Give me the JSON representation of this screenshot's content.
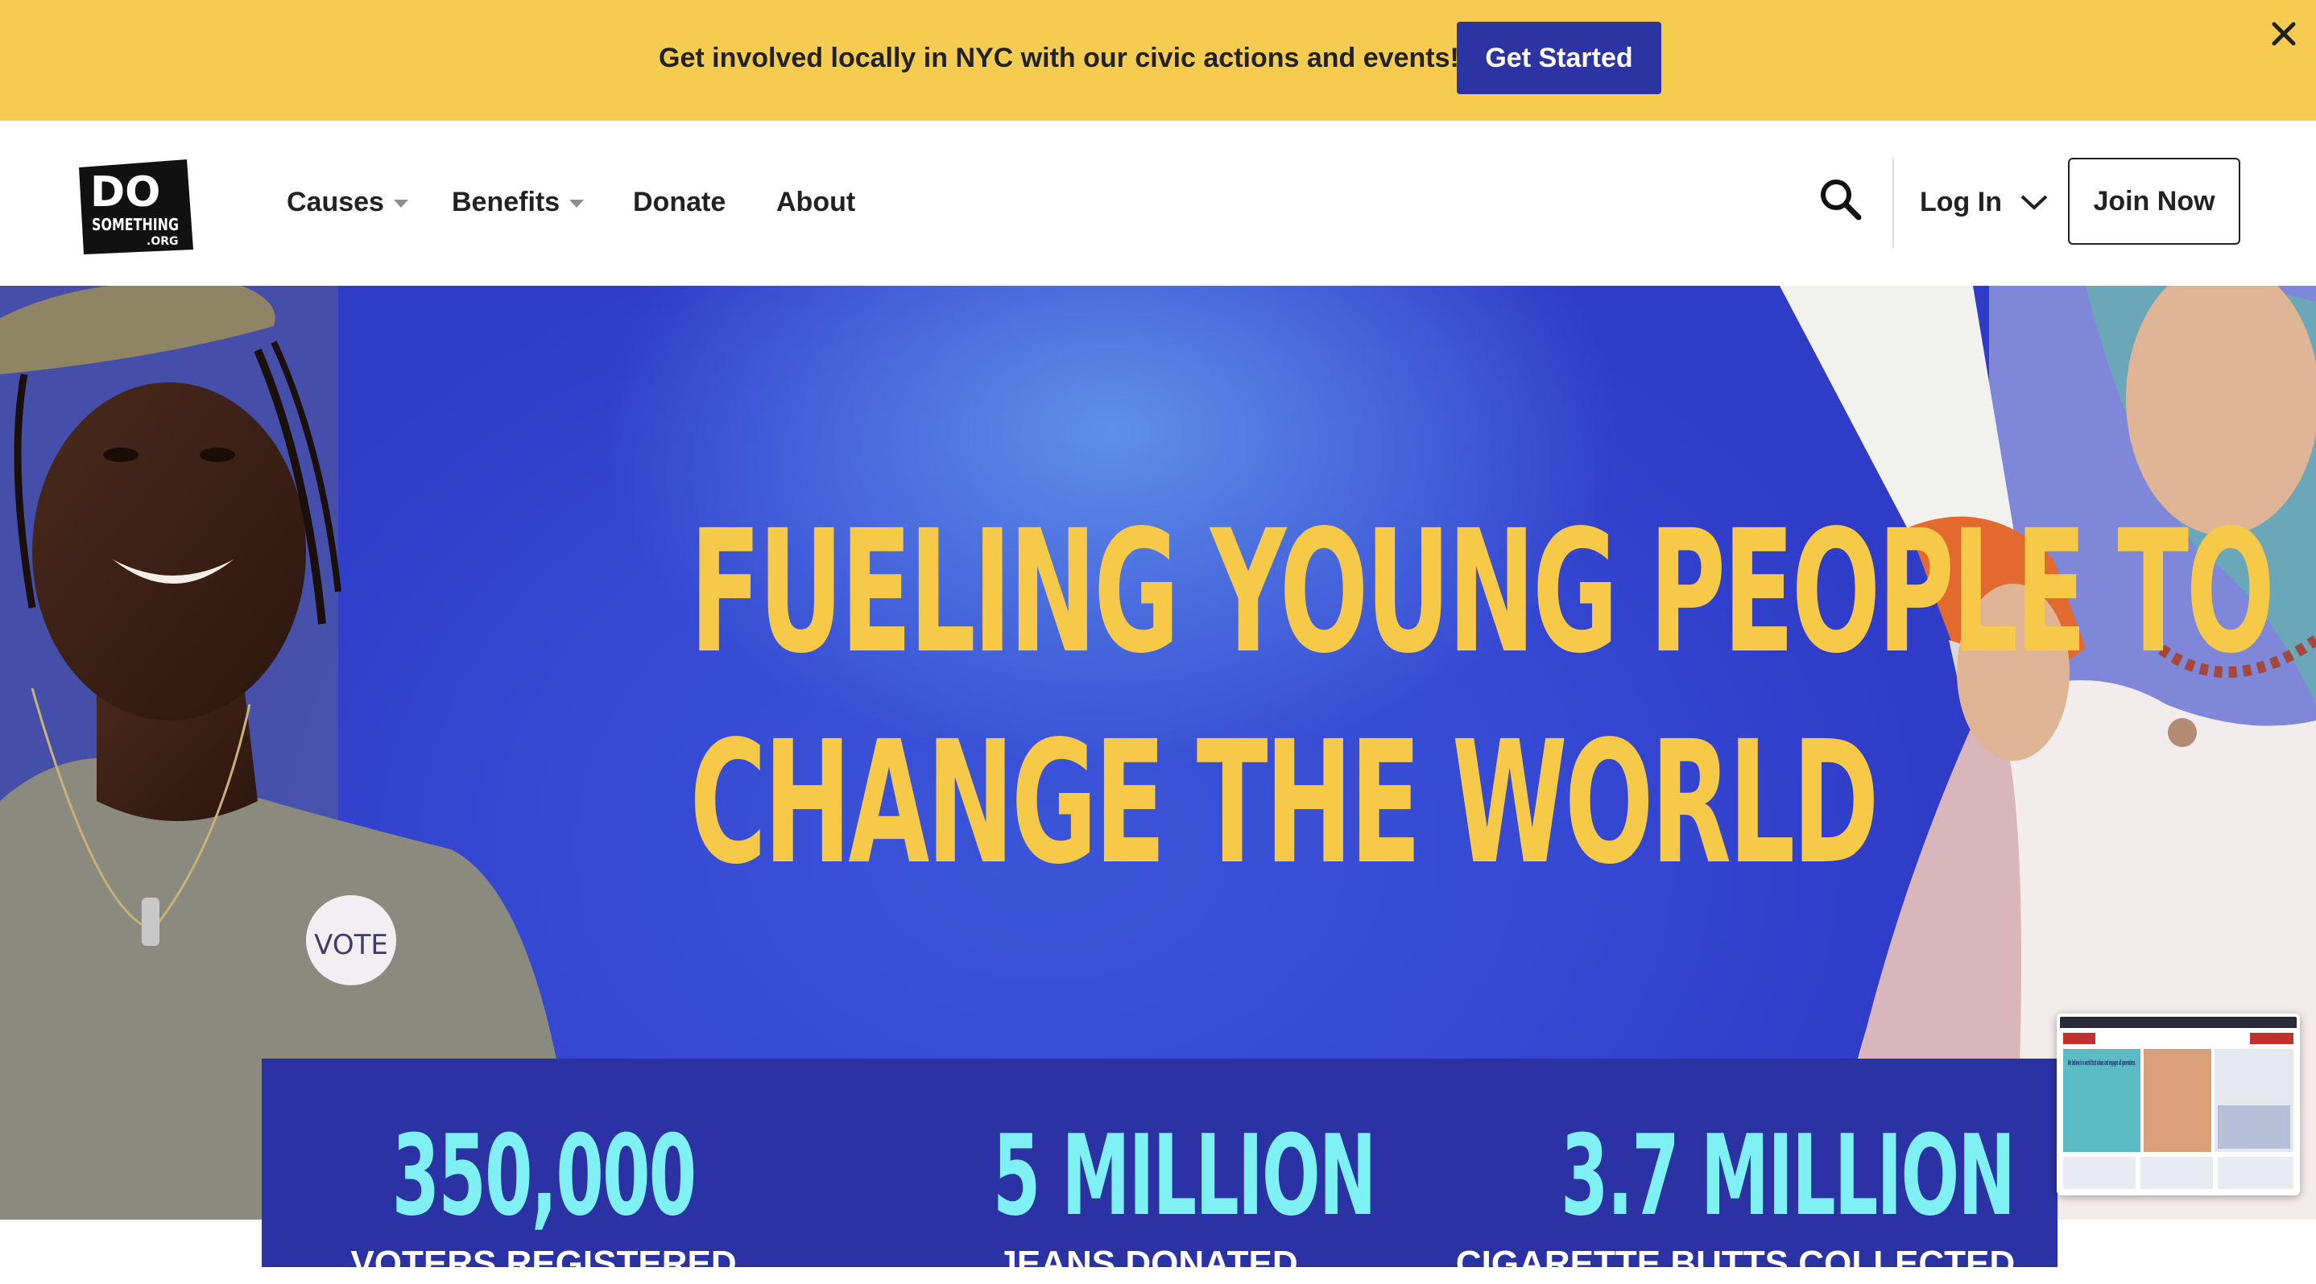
{
  "banner": {
    "text": "Get involved locally in NYC with our civic actions and events!",
    "cta_label": "Get Started",
    "close_icon": "close-icon"
  },
  "header": {
    "logo": {
      "line1": "DO",
      "line2": "SOMETHING",
      "line3": ".ORG"
    },
    "nav": [
      {
        "label": "Causes",
        "has_dropdown": true
      },
      {
        "label": "Benefits",
        "has_dropdown": true
      },
      {
        "label": "Donate",
        "has_dropdown": false
      },
      {
        "label": "About",
        "has_dropdown": false
      }
    ],
    "search_icon": "search-icon",
    "login_label": "Log In",
    "join_label": "Join Now"
  },
  "hero": {
    "headline_line1": "FUELING YOUNG PEOPLE TO",
    "headline_line2": "CHANGE THE WORLD",
    "badge_text": "VOTE"
  },
  "stats": [
    {
      "value": "350,000",
      "label": "VOTERS REGISTERED"
    },
    {
      "value": "5 MILLION",
      "label": "JEANS DONATED"
    },
    {
      "value": "3.7 MILLION",
      "label": "CIGARETTE BUTTS COLLECTED"
    }
  ],
  "thumbnail": {
    "text": "We believe in a world that values and engages all generations."
  },
  "colors": {
    "banner_bg": "#f6cc50",
    "cta_bg": "#2c33a2",
    "hero_blue": "#3548d2",
    "headline_yellow": "#f7c948",
    "stats_bg": "#2b33a4",
    "stats_number": "#7ff0f4"
  }
}
